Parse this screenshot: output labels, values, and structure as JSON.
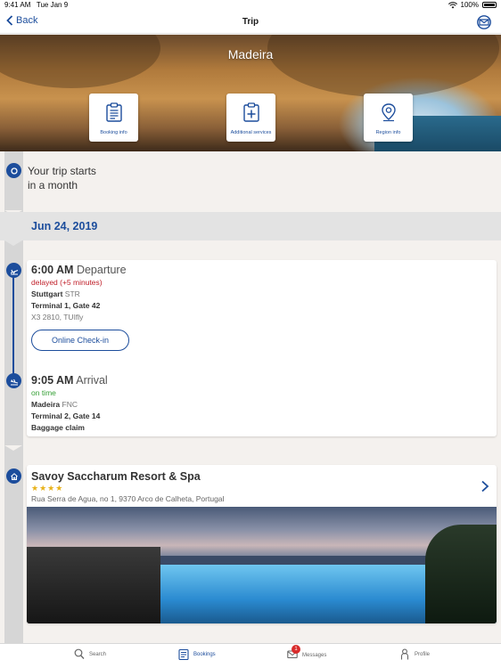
{
  "status_bar": {
    "time": "9:41 AM",
    "date": "Tue Jan 9",
    "battery": "100%"
  },
  "nav": {
    "back_label": "Back",
    "title": "Trip"
  },
  "hero": {
    "destination": "Madeira",
    "buttons": [
      {
        "label": "Booking info",
        "icon": "clipboard-icon"
      },
      {
        "label": "Additional services",
        "icon": "clipboard-plus-icon"
      },
      {
        "label": "Region info",
        "icon": "map-pin-icon"
      }
    ]
  },
  "trip_start": {
    "line1": "Your trip starts",
    "line2": "in a month"
  },
  "date_band": {
    "date": "Jun 24, 2019"
  },
  "flight": {
    "departure": {
      "time": "6:00 AM",
      "label": "Departure",
      "status": "delayed (+5 minutes)",
      "city": "Stuttgart",
      "code": "STR",
      "terminal": "Terminal 1, Gate 42",
      "flight": "X3 2810, TUIfly"
    },
    "checkin_label": "Online Check-in",
    "arrival": {
      "time": "9:05 AM",
      "label": "Arrival",
      "status": "on time",
      "city": "Madeira",
      "code": "FNC",
      "terminal": "Terminal 2, Gate 14",
      "extra": "Baggage claim"
    }
  },
  "hotel": {
    "name": "Savoy Saccharum Resort & Spa",
    "stars": "★★★★",
    "address": "Rua Serra de Agua, no 1, 9370 Arco de Calheta, Portugal"
  },
  "tab_bar": {
    "tabs": [
      {
        "label": "Search",
        "icon": "search-icon"
      },
      {
        "label": "Bookings",
        "icon": "bookings-icon",
        "active": true
      },
      {
        "label": "Messages",
        "icon": "envelope-icon",
        "badge": "1"
      },
      {
        "label": "Profile",
        "icon": "person-icon"
      }
    ]
  },
  "colors": {
    "accent": "#1c4d9c",
    "delayed": "#c0202a",
    "on_time": "#36a036",
    "stars": "#e8b21a"
  }
}
